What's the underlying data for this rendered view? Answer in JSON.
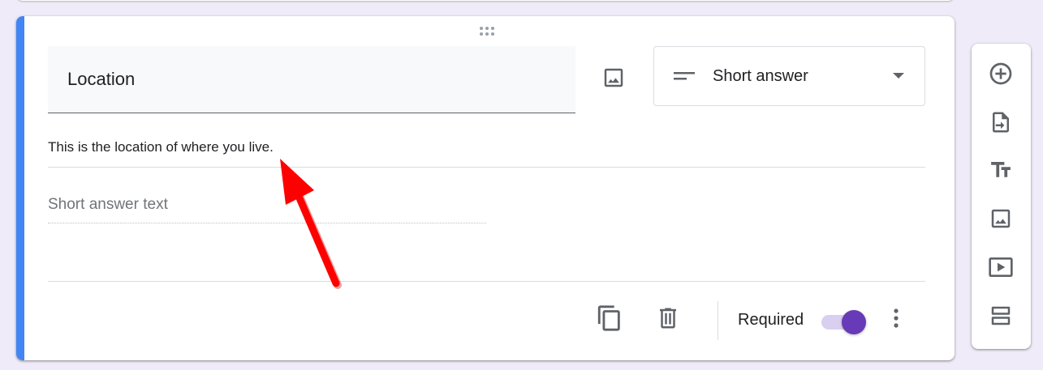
{
  "question": {
    "title": "Location",
    "description": "This is the location of where you live.",
    "answer_placeholder": "Short answer text",
    "type_label": "Short answer",
    "required_label": "Required",
    "required": true
  },
  "colors": {
    "accent_bar": "#4285f4",
    "toggle_on": "#673ab7",
    "toggle_track": "#d9cff0",
    "icon": "#5f6368",
    "annotation_arrow": "#ff0000",
    "page_background": "#f0ebf8"
  },
  "icons": {
    "drag": "drag-handle-icon",
    "image": "image-icon",
    "short_answer": "short-text-icon",
    "dropdown": "dropdown-arrow-icon",
    "duplicate": "duplicate-icon",
    "delete": "delete-icon",
    "more": "more-vert-icon",
    "toolbar": [
      "add-question-icon",
      "import-questions-icon",
      "add-title-icon",
      "add-image-icon",
      "add-video-icon",
      "add-section-icon"
    ]
  }
}
